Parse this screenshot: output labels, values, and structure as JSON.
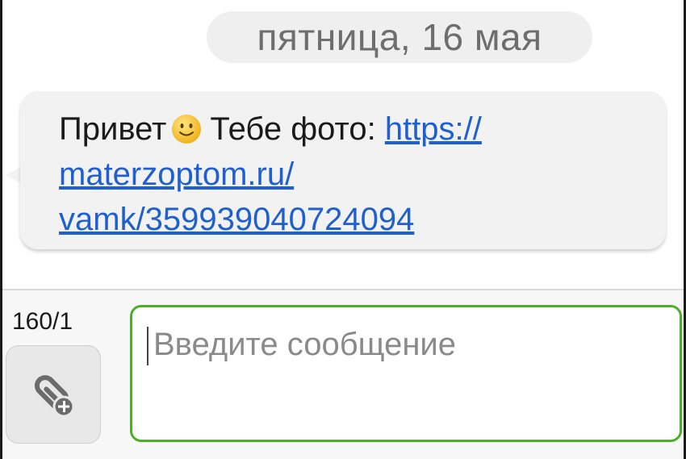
{
  "date_divider": "пятница, 16 мая",
  "message": {
    "text_before": "Привет",
    "emoji": "smiley-emoji",
    "text_after": "Тебе фото:",
    "link_line1": "https://",
    "link_line2": "materzoptom.ru/",
    "link_line3": "vamk/359939040724094"
  },
  "composer": {
    "counter": "160/1",
    "attach_icon": "paperclip-plus-icon",
    "placeholder": "Введите сообщение"
  },
  "colors": {
    "link": "#1f5fcf",
    "input_border": "#4caf2a",
    "bubble": "#f2f2f2",
    "date_pill": "#efefef"
  }
}
